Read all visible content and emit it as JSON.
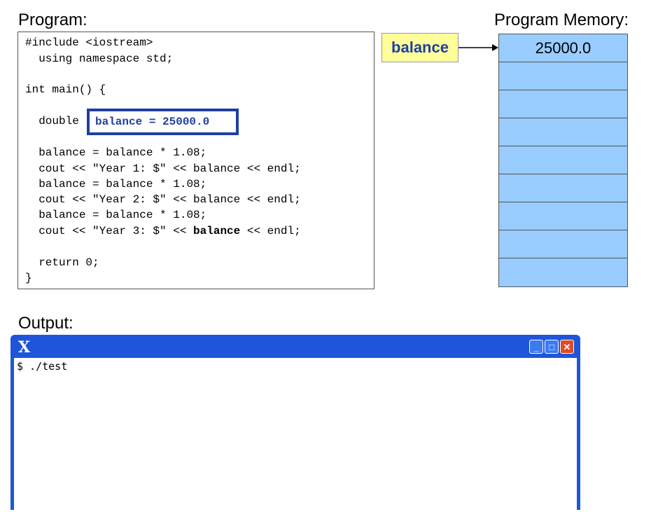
{
  "headings": {
    "program": "Program:",
    "memory": "Program Memory:",
    "output": "Output:"
  },
  "code": {
    "lines": [
      "#include <iostream>",
      "  using namespace std;",
      "",
      "int main() {",
      "",
      "  double",
      "",
      "  balance = balance * 1.08;",
      "  cout << \"Year 1: $\" << balance << endl;",
      "  balance = balance * 1.08;",
      "  cout << \"Year 2: $\" << balance << endl;",
      "  balance = balance * 1.08;",
      "  cout << \"Year 3: $\" << ",
      "",
      "  return 0;",
      "}"
    ],
    "year3_bold": "balance",
    "year3_tail": " << endl;",
    "highlight": "balance = 25000.0"
  },
  "memory": {
    "variable_label": "balance",
    "cells": [
      "25000.0",
      "",
      "",
      "",
      "",
      "",
      "",
      "",
      ""
    ],
    "label_bg": "#ffff99",
    "cell_bg": "#99ccff",
    "accent": "#1f3fa0"
  },
  "terminal": {
    "logo": "X",
    "minimize": "_",
    "maximize": "□",
    "close": "✕",
    "lines": [
      "$ ./test"
    ],
    "frame_color": "#1f56d9"
  }
}
